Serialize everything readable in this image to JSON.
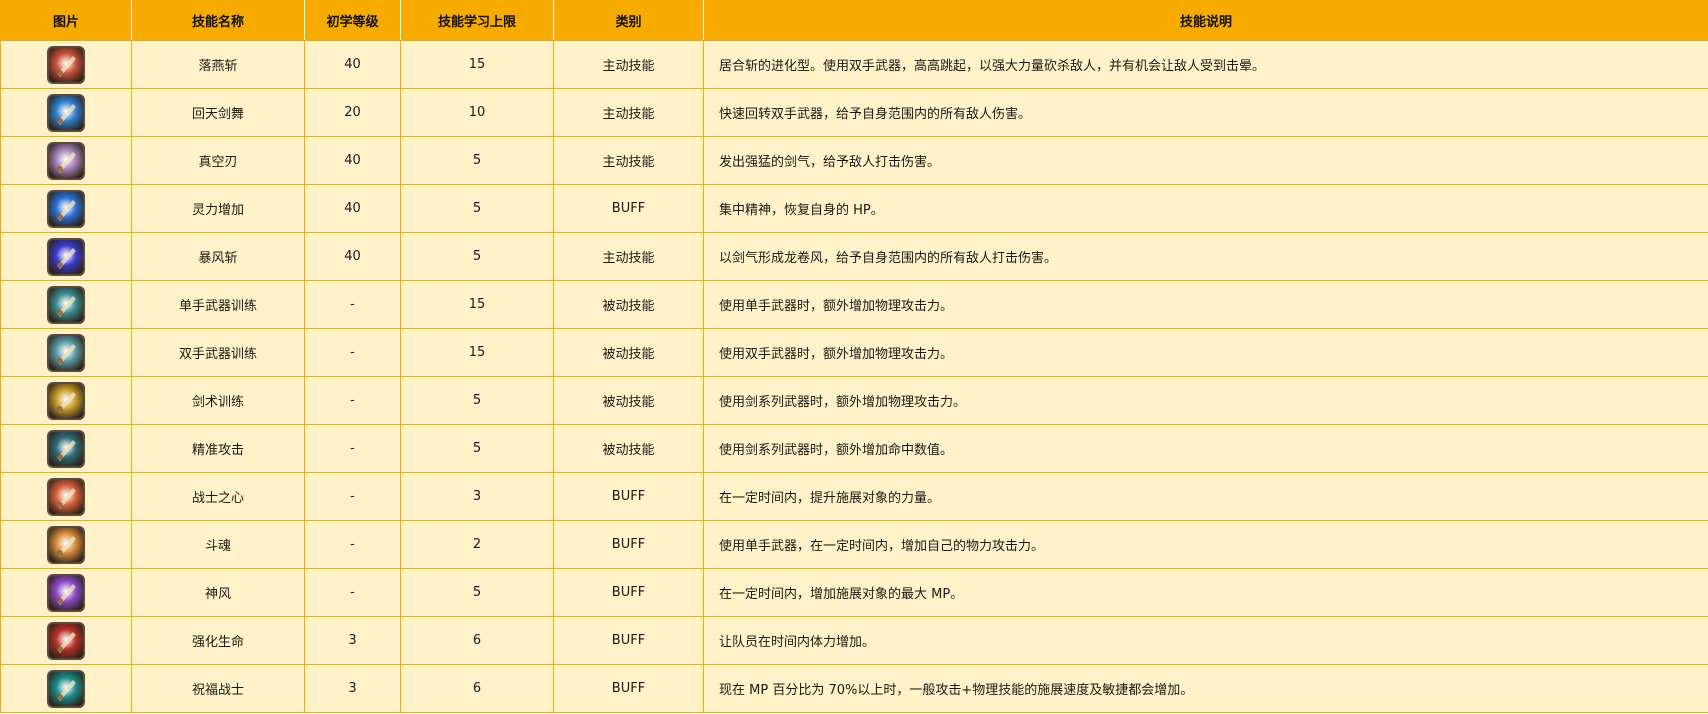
{
  "header": {
    "image": "图片",
    "name": "技能名称",
    "level": "初学等级",
    "max": "技能学习上限",
    "type": "类别",
    "desc": "技能说明"
  },
  "rows": [
    {
      "icon": "falling-swallow-slash-icon",
      "name": "落燕斩",
      "level": "40",
      "max": "15",
      "type": "主动技能",
      "desc": "居合斩的进化型。使用双手武器，高高跳起，以强大力量砍杀敌人，并有机会让敌人受到击晕。",
      "color": "#c8503a"
    },
    {
      "icon": "whirlwind-sword-dance-icon",
      "name": "回天剑舞",
      "level": "20",
      "max": "10",
      "type": "主动技能",
      "desc": "快速回转双手武器，给予自身范围内的所有敌人伤害。",
      "color": "#2f7fd0"
    },
    {
      "icon": "vacuum-blade-icon",
      "name": "真空刃",
      "level": "40",
      "max": "5",
      "type": "主动技能",
      "desc": "发出强猛的剑气，给予敌人打击伤害。",
      "color": "#a77fb8"
    },
    {
      "icon": "spirit-boost-icon",
      "name": "灵力增加",
      "level": "40",
      "max": "5",
      "type": "BUFF",
      "desc": "集中精神，恢复自身的 HP。",
      "color": "#2b6fd6"
    },
    {
      "icon": "storm-slash-icon",
      "name": "暴风斩",
      "level": "40",
      "max": "5",
      "type": "主动技能",
      "desc": "以剑气形成龙卷风，给予自身范围内的所有敌人打击伤害。",
      "color": "#3a3ad0"
    },
    {
      "icon": "one-hand-weapon-training-icon",
      "name": "单手武器训练",
      "level": "-",
      "max": "15",
      "type": "被动技能",
      "desc": "使用单手武器时，额外增加物理攻击力。",
      "color": "#3b8a8f"
    },
    {
      "icon": "two-hand-weapon-training-icon",
      "name": "双手武器训练",
      "level": "-",
      "max": "15",
      "type": "被动技能",
      "desc": "使用双手武器时，额外增加物理攻击力。",
      "color": "#5a9aa8"
    },
    {
      "icon": "swordsmanship-training-icon",
      "name": "剑术训练",
      "level": "-",
      "max": "5",
      "type": "被动技能",
      "desc": "使用剑系列武器时，额外增加物理攻击力。",
      "color": "#c89a2a"
    },
    {
      "icon": "precision-attack-icon",
      "name": "精准攻击",
      "level": "-",
      "max": "5",
      "type": "被动技能",
      "desc": "使用剑系列武器时，额外增加命中数值。",
      "color": "#2f6a78"
    },
    {
      "icon": "warrior-heart-icon",
      "name": "战士之心",
      "level": "-",
      "max": "3",
      "type": "BUFF",
      "desc": "在一定时间内，提升施展对象的力量。",
      "color": "#d8603a"
    },
    {
      "icon": "fighting-spirit-icon",
      "name": "斗魂",
      "level": "-",
      "max": "2",
      "type": "BUFF",
      "desc": "使用单手武器，在一定时间内，增加自己的物力攻击力。",
      "color": "#d88a3a"
    },
    {
      "icon": "divine-wind-icon",
      "name": "神风",
      "level": "-",
      "max": "5",
      "type": "BUFF",
      "desc": "在一定时间内，增加施展对象的最大 MP。",
      "color": "#8a4ac8"
    },
    {
      "icon": "enhanced-life-icon",
      "name": "强化生命",
      "level": "3",
      "max": "6",
      "type": "BUFF",
      "desc": "让队员在时间内体力增加。",
      "color": "#b8302a"
    },
    {
      "icon": "blessed-warrior-icon",
      "name": "祝福战士",
      "level": "3",
      "max": "6",
      "type": "BUFF",
      "desc": "现在 MP 百分比为 70%以上时，一般攻击+物理技能的施展速度及敏捷都会增加。",
      "color": "#1a8a8a"
    }
  ]
}
